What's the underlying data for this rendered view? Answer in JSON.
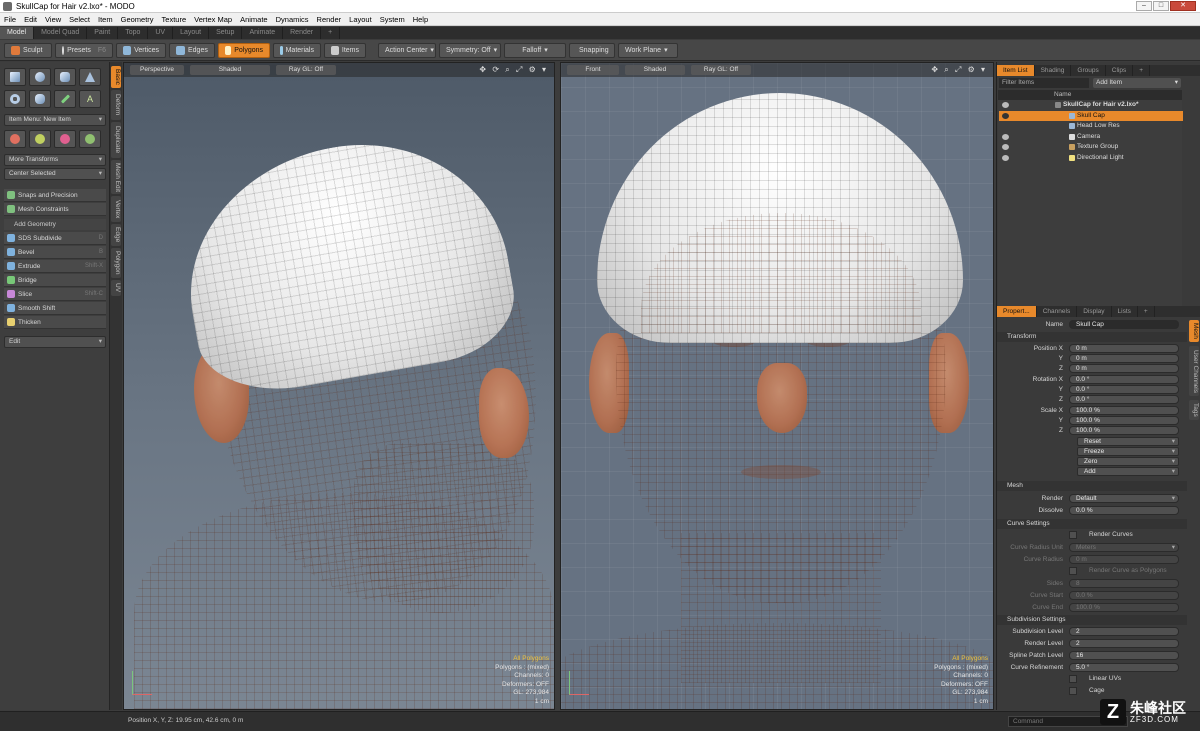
{
  "window": {
    "title": "SkullCap for Hair v2.lxo* - MODO"
  },
  "menubar": [
    "File",
    "Edit",
    "View",
    "Select",
    "Item",
    "Geometry",
    "Texture",
    "Vertex Map",
    "Animate",
    "Dynamics",
    "Render",
    "Layout",
    "System",
    "Help"
  ],
  "layout_tabs": [
    "Model",
    "Model Quad",
    "Paint",
    "Topo",
    "UV",
    "Layout",
    "Setup",
    "Animate",
    "Render",
    "+"
  ],
  "toolbar": {
    "sculpt": "Sculpt",
    "presets": "Presets",
    "presets_shortcut": "F6",
    "vertices": "Vertices",
    "edges": "Edges",
    "polygons": "Polygons",
    "materials": "Materials",
    "items": "Items",
    "action_center": "Action Center",
    "symmetry": "Symmetry: Off",
    "falloff": "Falloff",
    "snapping": "Snapping",
    "work_plane": "Work Plane"
  },
  "left_panel": {
    "item_menu": "Item Menu: New Item",
    "more_transforms": "More Transforms",
    "center_selected": "Center Selected",
    "snaps": "Snaps and Precision",
    "mesh_constraints": "Mesh Constraints",
    "add_geometry": "Add Geometry",
    "tools": [
      {
        "label": "SDS Subdivide",
        "shortcut": "D"
      },
      {
        "label": "Bevel",
        "shortcut": "B"
      },
      {
        "label": "Extrude",
        "shortcut": "Shift-X"
      },
      {
        "label": "Bridge",
        "shortcut": ""
      },
      {
        "label": "Slice",
        "shortcut": "Shift-C"
      },
      {
        "label": "Smooth Shift",
        "shortcut": ""
      },
      {
        "label": "Thicken",
        "shortcut": ""
      }
    ],
    "edit": "Edit"
  },
  "vertical_tabs": [
    "Basic",
    "Deform",
    "Duplicate",
    "Mesh Edit",
    "Vertex",
    "Edge",
    "Polygon",
    "UV"
  ],
  "viewport_left": {
    "projection": "Perspective",
    "shading": "Shaded",
    "raygl": "Ray GL: Off",
    "stats": [
      "All Polygons",
      "Polygons : (mixed)",
      "Channels: 0",
      "Deformers: OFF",
      "GL: 273,984",
      "1 cm"
    ]
  },
  "viewport_right": {
    "projection": "Front",
    "shading": "Shaded",
    "raygl": "Ray GL: Off",
    "stats": [
      "All Polygons",
      "Polygons : (mixed)",
      "Channels: 0",
      "Deformers: OFF",
      "GL: 273,984",
      "1 cm"
    ]
  },
  "item_list": {
    "tabs": [
      "Item List",
      "Shading",
      "Groups",
      "Clips",
      "+"
    ],
    "filter": "Filter Items",
    "add_item": "Add Item",
    "column_name": "Name",
    "items": [
      "SkullCap for Hair v2.lxo*",
      "Skull Cap",
      "Head Low Res",
      "Camera",
      "Texture Group",
      "Directional Light"
    ]
  },
  "properties": {
    "tabs": [
      "Propert...",
      "Channels",
      "Display",
      "Lists",
      "+"
    ],
    "side_tabs": [
      "Mesh",
      "User Channels",
      "Tags"
    ],
    "name_label": "Name",
    "name_value": "Skull Cap",
    "transform": "Transform",
    "position": [
      {
        "l": "Position X",
        "v": "0 m"
      },
      {
        "l": "Y",
        "v": "0 m"
      },
      {
        "l": "Z",
        "v": "0 m"
      }
    ],
    "rotation": [
      {
        "l": "Rotation X",
        "v": "0.0 °"
      },
      {
        "l": "Y",
        "v": "0.0 °"
      },
      {
        "l": "Z",
        "v": "0.0 °"
      }
    ],
    "scale": [
      {
        "l": "Scale X",
        "v": "100.0 %"
      },
      {
        "l": "Y",
        "v": "100.0 %"
      },
      {
        "l": "Z",
        "v": "100.0 %"
      }
    ],
    "actions": [
      "Reset",
      "Freeze",
      "Zero",
      "Add"
    ],
    "mesh": "Mesh",
    "render_label": "Render",
    "render_value": "Default",
    "dissolve_label": "Dissolve",
    "dissolve_value": "0.0 %",
    "curve_settings": "Curve Settings",
    "render_curves": "Render Curves",
    "curve_radius_unit": "Curve Radius Unit",
    "curve_radius_unit_value": "Meters",
    "curve_radius": "Curve Radius",
    "curve_radius_value": "0 m",
    "render_curve_polys": "Render Curve as Polygons",
    "sides": "Sides",
    "sides_value": "8",
    "curve_start": "Curve Start",
    "curve_start_value": "0.0 %",
    "curve_end": "Curve End",
    "curve_end_value": "100.0 %",
    "subdivision_settings": "Subdivision Settings",
    "subdivision_level": "Subdivision Level",
    "subdivision_level_value": "2",
    "render_level": "Render Level",
    "render_level_value": "2",
    "spline_patch_level": "Spline Patch Level",
    "spline_patch_level_value": "16",
    "curve_refinement": "Curve Refinement",
    "curve_refinement_value": "5.0 °",
    "linear_uvs": "Linear UVs",
    "cage": "Cage"
  },
  "statusbar": {
    "position": "Position X, Y, Z:  19.95 cm, 42.6 cm, 0 m",
    "command": "Command"
  },
  "watermark": {
    "text": "朱峰社区",
    "sub": "ZF3D.COM"
  }
}
